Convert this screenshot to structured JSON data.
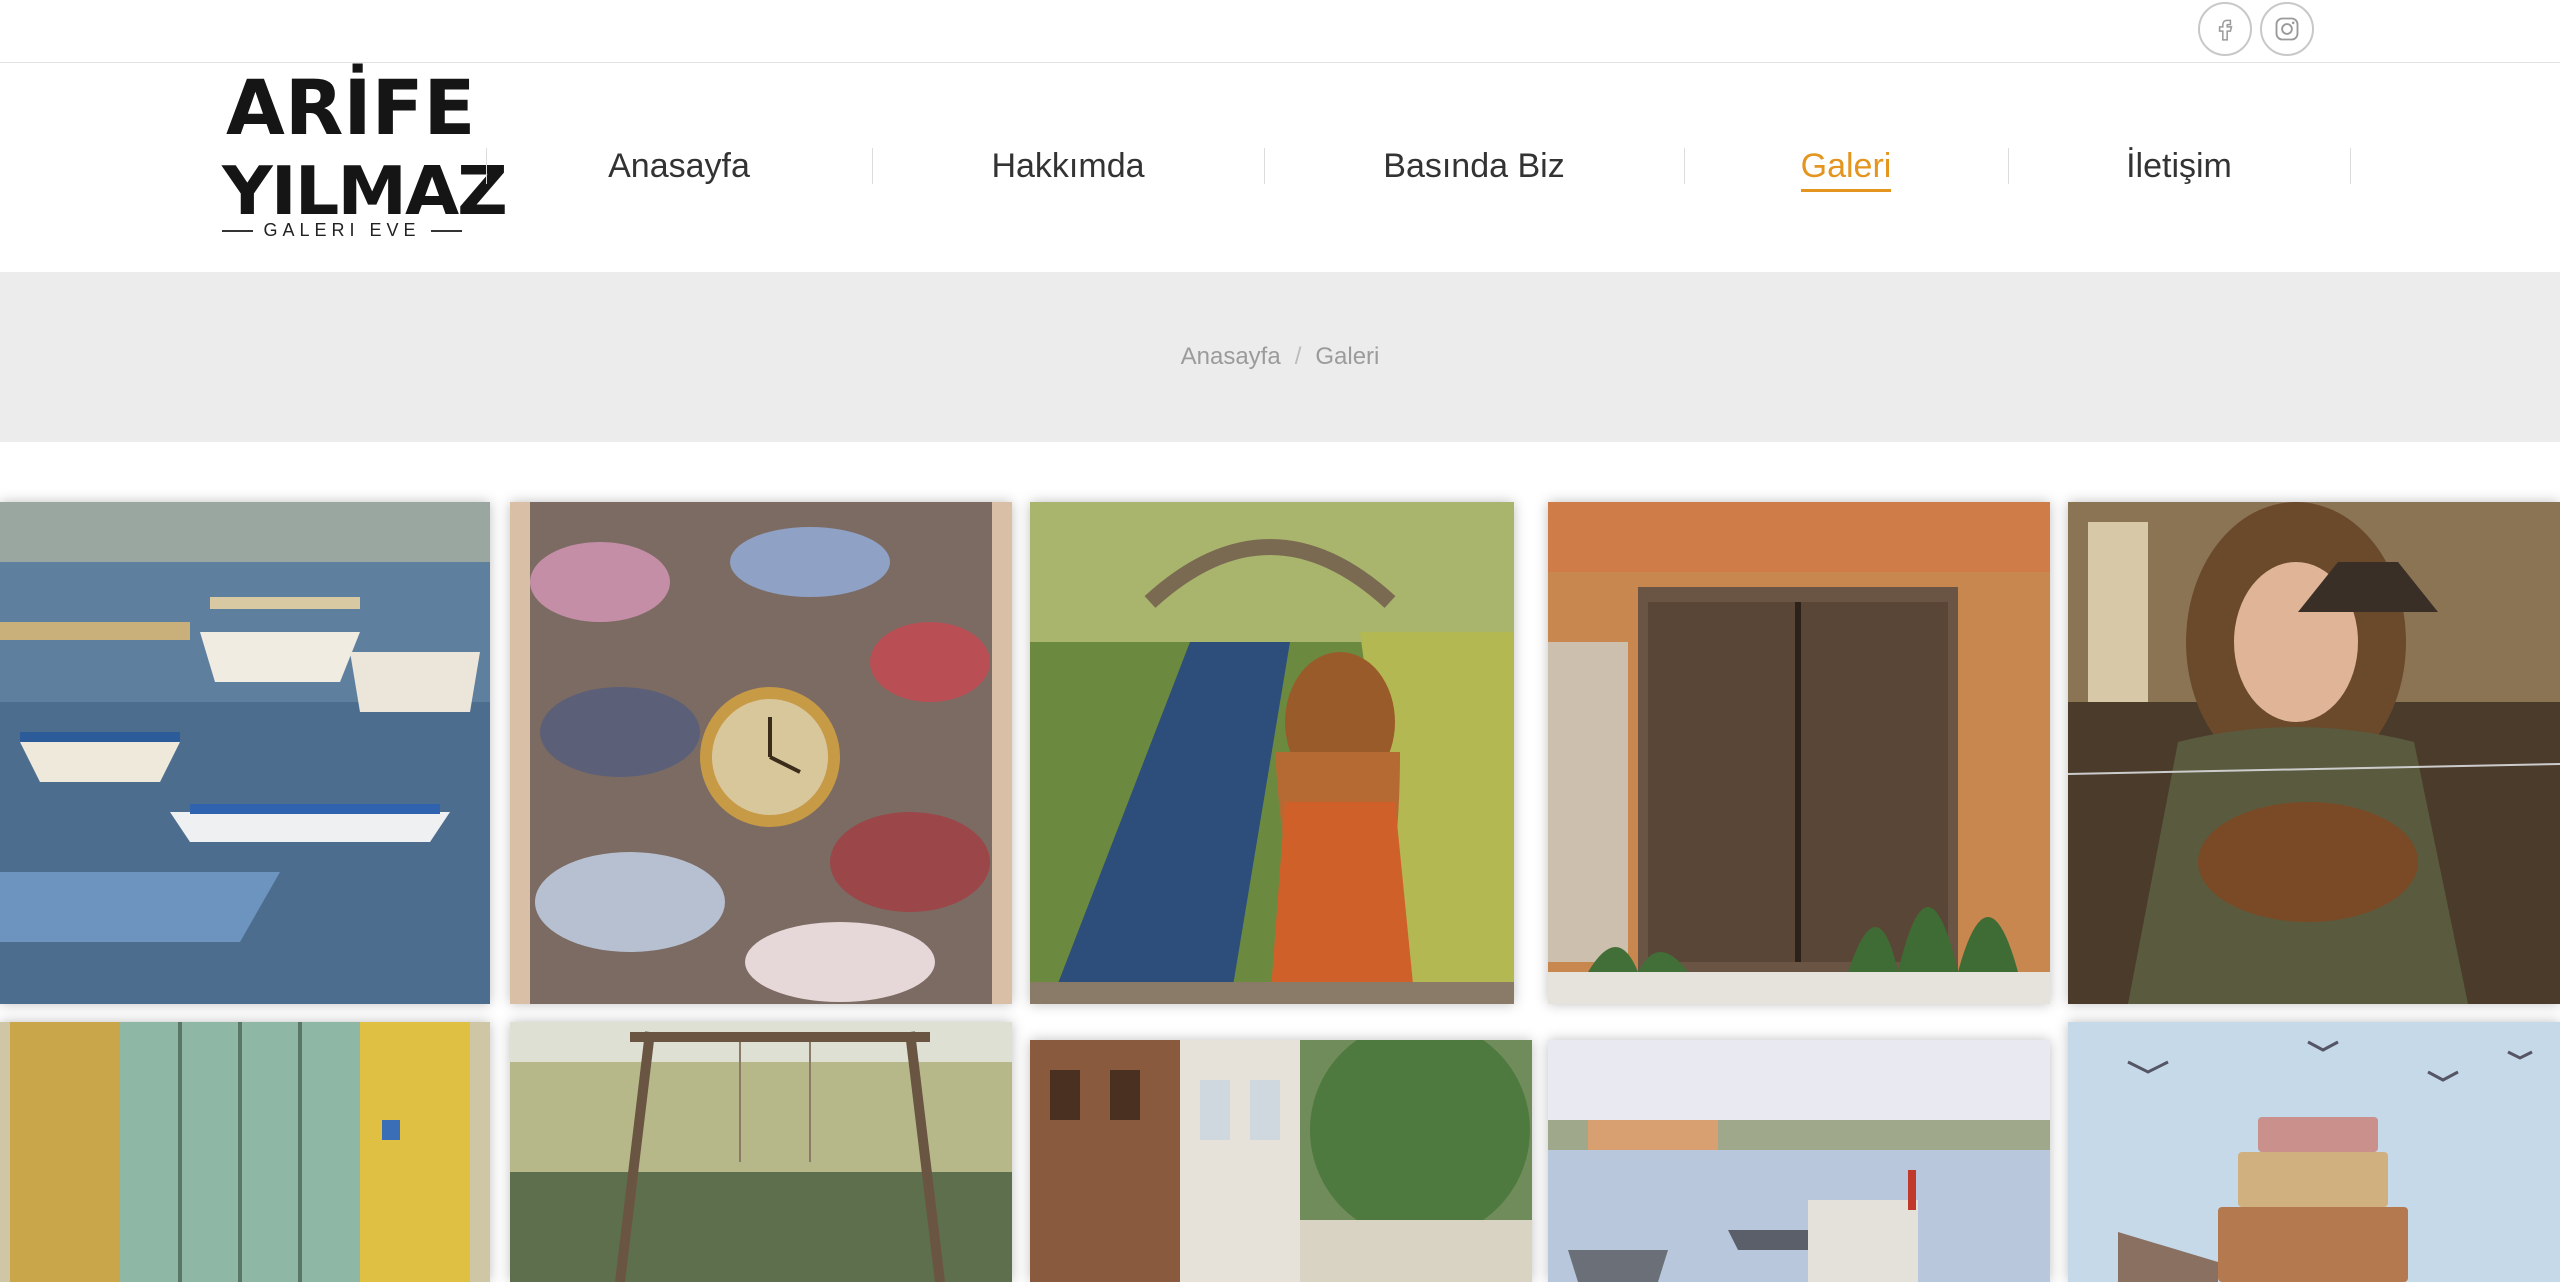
{
  "social": {
    "facebook_icon": "facebook-icon",
    "instagram_icon": "instagram-icon"
  },
  "logo": {
    "line1": "ARİFE",
    "line2": "YILMAZ",
    "sub": "GALERI EVE"
  },
  "nav": {
    "items": [
      {
        "label": "Anasayfa"
      },
      {
        "label": "Hakkımda"
      },
      {
        "label": "Basında Biz"
      },
      {
        "label": "Galeri",
        "active": true
      },
      {
        "label": "İletişim"
      }
    ]
  },
  "breadcrumb": {
    "home": "Anasayfa",
    "separator": "/",
    "current": "Galeri"
  },
  "colors": {
    "accent": "#e3951f",
    "text": "#333333",
    "titlebar_bg": "#ececec"
  },
  "gallery": {
    "items": [
      {
        "subject": "harbor boats painting"
      },
      {
        "subject": "pile of shoes with clock painting"
      },
      {
        "subject": "woman by stream with arch bridge painting"
      },
      {
        "subject": "old wooden door painting"
      },
      {
        "subject": "smiling woman with keys painting"
      },
      {
        "subject": "green wooden door painting"
      },
      {
        "subject": "swing by lake painting"
      },
      {
        "subject": "old wooden houses street painting"
      },
      {
        "subject": "seaside town with boats painting"
      },
      {
        "subject": "stacked suitcases with seagulls painting"
      }
    ]
  }
}
